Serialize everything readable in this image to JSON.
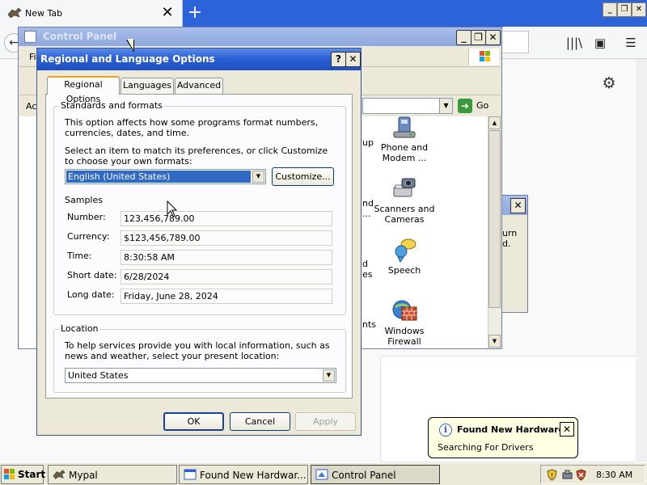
{
  "browser": {
    "tab_title": "New Tab",
    "tab_close": "✕",
    "new_tab": "+",
    "window_min": "_",
    "window_restore": "❐",
    "window_close": "✕",
    "back_arrow": "←",
    "library_icon": "|||\\",
    "sidebar_icon": "▣",
    "menu_icon": "☰",
    "settings_icon": "⚙"
  },
  "control_panel": {
    "title": "Control Panel",
    "menubar_fragment": "Fi",
    "address_fragment": "Ac",
    "go_label": "Go",
    "items": [
      {
        "label": "Phone and Modem ...",
        "icon": "phone-modem-icon"
      },
      {
        "label": "Scanners and Cameras",
        "icon": "scanner-camera-icon"
      },
      {
        "label": "Speech",
        "icon": "speech-icon"
      },
      {
        "label": "Windows Firewall",
        "icon": "firewall-icon"
      }
    ],
    "left_fragments": [
      "up",
      "nd",
      "...",
      "d",
      "es",
      "nts"
    ]
  },
  "found_hw_window": {
    "fragment_1": "urn",
    "fragment_2": "d."
  },
  "dialog": {
    "title": "Regional and Language Options",
    "help_label": "?",
    "close_label": "✕",
    "tabs": [
      {
        "label": "Regional Options",
        "active": true
      },
      {
        "label": "Languages",
        "active": false
      },
      {
        "label": "Advanced",
        "active": false
      }
    ],
    "standards": {
      "group_title": "Standards and formats",
      "description": "This option affects how some programs format numbers, currencies, dates, and time.",
      "select_prompt": "Select an item to match its preferences, or click Customize to choose your own formats:",
      "selected_format": "English (United States)",
      "customize_label": "Customize...",
      "samples_heading": "Samples",
      "samples": [
        {
          "label": "Number:",
          "value": "123,456,789.00"
        },
        {
          "label": "Currency:",
          "value": "$123,456,789.00"
        },
        {
          "label": "Time:",
          "value": "8:30:58 AM"
        },
        {
          "label": "Short date:",
          "value": "6/28/2024"
        },
        {
          "label": "Long date:",
          "value": "Friday, June 28, 2024"
        }
      ]
    },
    "location": {
      "group_title": "Location",
      "description": "To help services provide you with local information, such as news and weather, select your present location:",
      "selected_location": "United States"
    },
    "buttons": {
      "ok": "OK",
      "cancel": "Cancel",
      "apply": "Apply"
    }
  },
  "balloon": {
    "title": "Found New Hardware",
    "text": "Searching For Drivers",
    "close": "✕",
    "info_icon": "i"
  },
  "taskbar": {
    "start_label": "Start",
    "tasks": [
      {
        "label": "Mypal",
        "active": false
      },
      {
        "label": "Found New Hardwar...",
        "active": false
      },
      {
        "label": "Control Panel",
        "active": true
      }
    ],
    "clock": "8:30 AM"
  },
  "colors": {
    "xp_title_blue": "#2a5fd1",
    "dialog_face": "#ece9d8",
    "selection_blue": "#316ac5",
    "browser_tabstrip": "#2d63d8",
    "balloon_bg": "#ffffe1"
  }
}
